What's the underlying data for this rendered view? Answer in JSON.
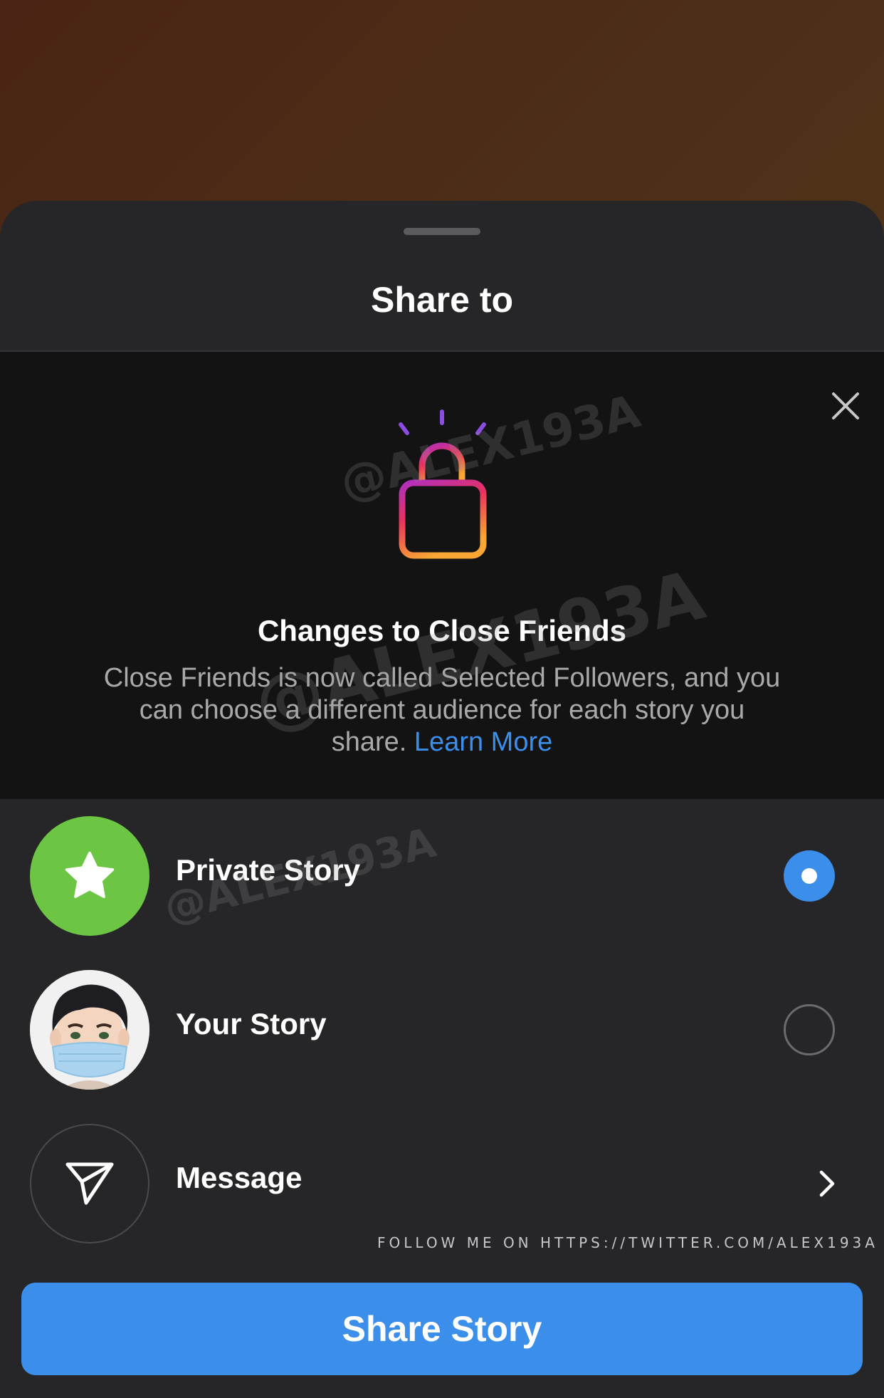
{
  "sheet": {
    "title": "Share to"
  },
  "notice": {
    "title": "Changes to Close Friends",
    "body": "Close Friends is now called Selected Followers, and you can choose a different audience for each story you share. ",
    "learn_more": "Learn More",
    "icons": [
      "close-icon",
      "lock-icon"
    ]
  },
  "options": [
    {
      "label": "Private Story",
      "icon": "star-icon",
      "control": "radio",
      "selected": true
    },
    {
      "label": "Your Story",
      "icon": "user-avatar",
      "control": "radio",
      "selected": false
    },
    {
      "label": "Message",
      "icon": "send-icon",
      "control": "chevron-right-icon"
    }
  ],
  "watermark": {
    "handle": "@ALEX193A",
    "follow": "FOLLOW ME ON HTTPS://TWITTER.COM/ALEX193A"
  },
  "footer": {
    "share_button": "Share Story"
  },
  "colors": {
    "accent": "#3b8eea",
    "sheet": "#262628",
    "notice_bg": "#131313",
    "private_green": "#6cc644"
  }
}
